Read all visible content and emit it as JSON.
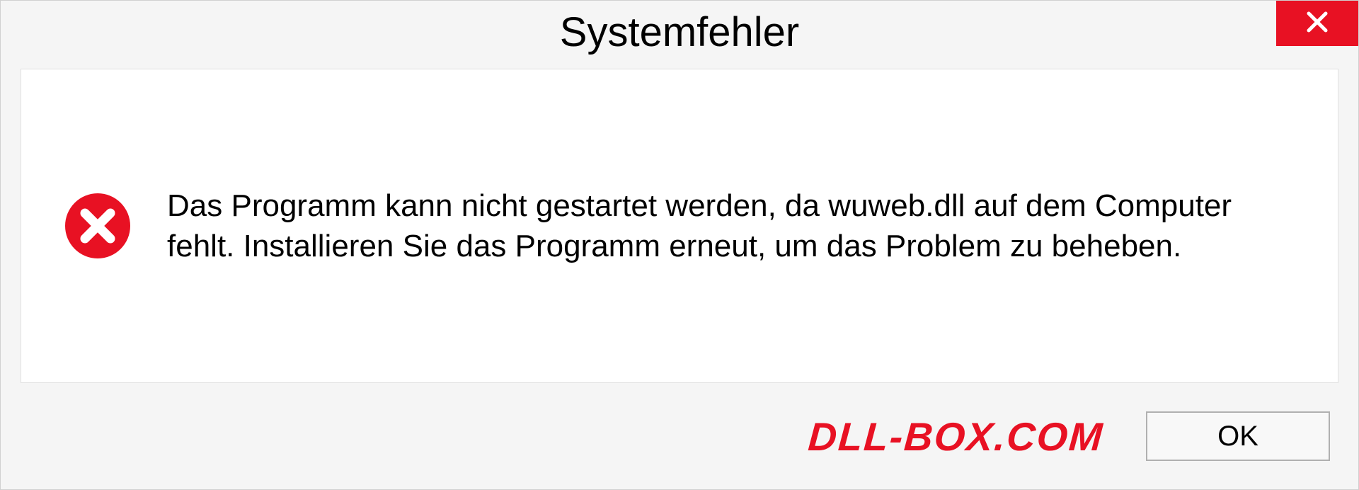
{
  "dialog": {
    "title": "Systemfehler",
    "message": "Das Programm kann nicht gestartet werden, da wuweb.dll auf dem Computer fehlt. Installieren Sie das Programm erneut, um das Problem zu beheben.",
    "ok_label": "OK",
    "watermark": "DLL-BOX.COM"
  }
}
